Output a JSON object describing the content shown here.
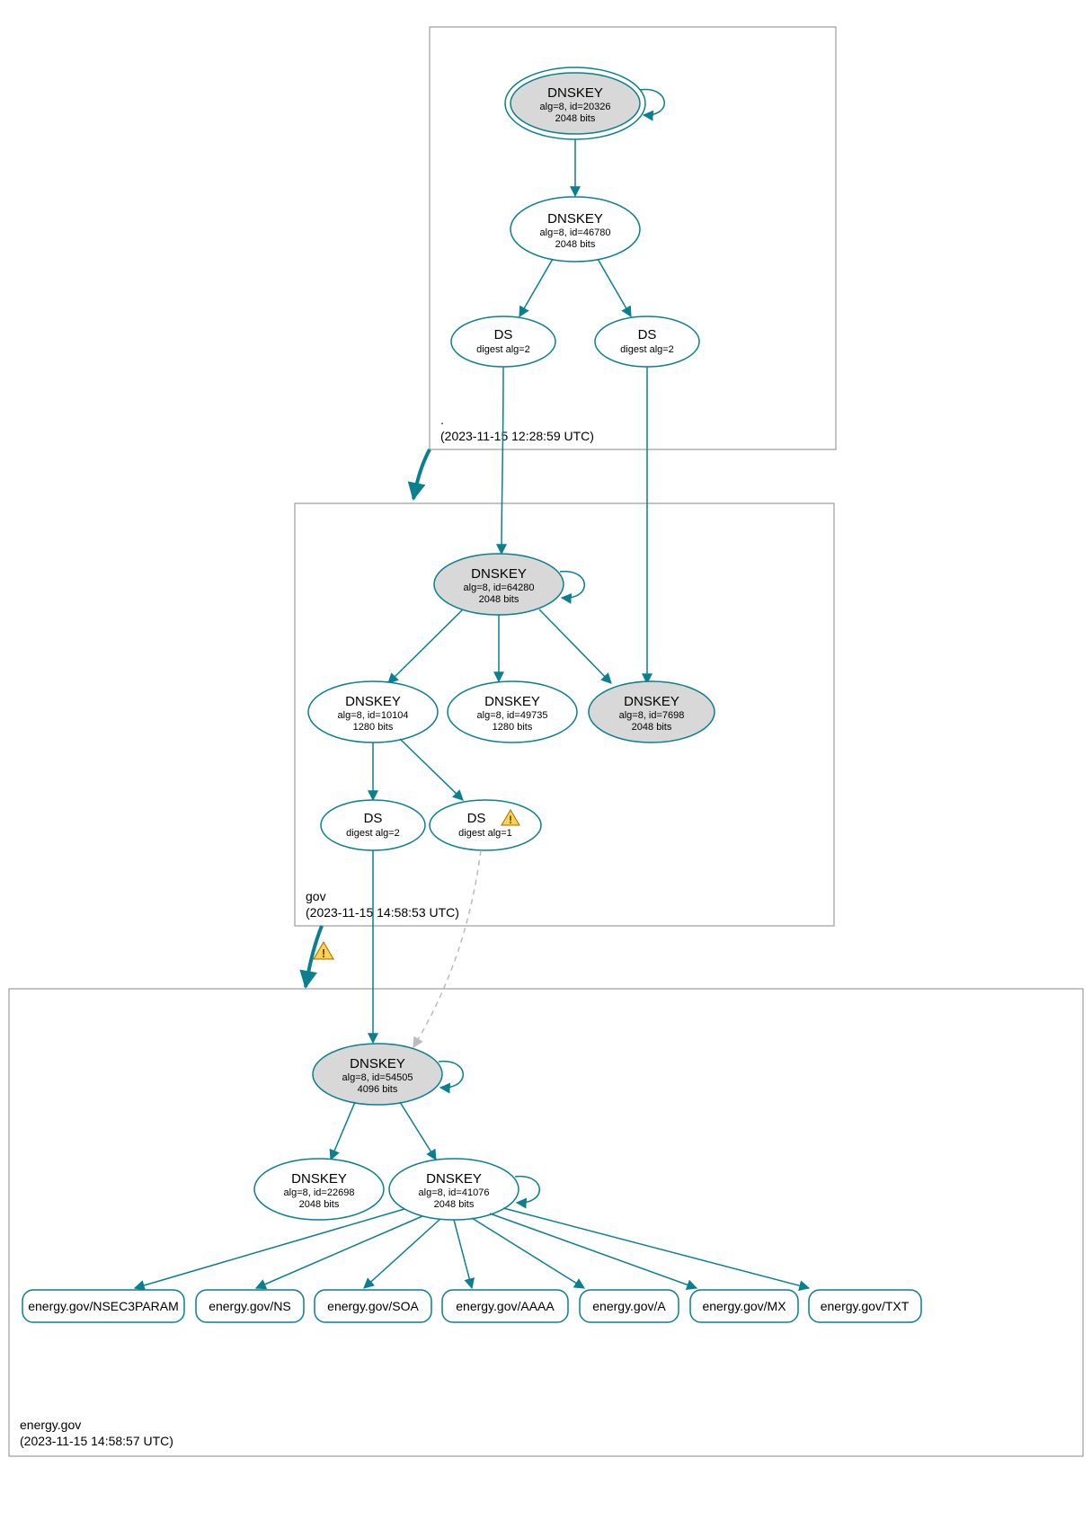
{
  "zones": {
    "root": {
      "name": ".",
      "timestamp": "(2023-11-15 12:28:59 UTC)"
    },
    "gov": {
      "name": "gov",
      "timestamp": "(2023-11-15 14:58:53 UTC)"
    },
    "energy": {
      "name": "energy.gov",
      "timestamp": "(2023-11-15 14:58:57 UTC)"
    }
  },
  "nodes": {
    "root_ksk": {
      "title": "DNSKEY",
      "sub": "alg=8, id=20326",
      "sub2": "2048 bits"
    },
    "root_zsk": {
      "title": "DNSKEY",
      "sub": "alg=8, id=46780",
      "sub2": "2048 bits"
    },
    "root_ds1": {
      "title": "DS",
      "sub": "digest alg=2"
    },
    "root_ds2": {
      "title": "DS",
      "sub": "digest alg=2"
    },
    "gov_ksk": {
      "title": "DNSKEY",
      "sub": "alg=8, id=64280",
      "sub2": "2048 bits"
    },
    "gov_zsk1": {
      "title": "DNSKEY",
      "sub": "alg=8, id=10104",
      "sub2": "1280 bits"
    },
    "gov_zsk2": {
      "title": "DNSKEY",
      "sub": "alg=8, id=49735",
      "sub2": "1280 bits"
    },
    "gov_key3": {
      "title": "DNSKEY",
      "sub": "alg=8, id=7698",
      "sub2": "2048 bits"
    },
    "gov_ds1": {
      "title": "DS",
      "sub": "digest alg=2"
    },
    "gov_ds2": {
      "title": "DS",
      "sub": "digest alg=1"
    },
    "en_ksk": {
      "title": "DNSKEY",
      "sub": "alg=8, id=54505",
      "sub2": "4096 bits"
    },
    "en_zsk1": {
      "title": "DNSKEY",
      "sub": "alg=8, id=22698",
      "sub2": "2048 bits"
    },
    "en_zsk2": {
      "title": "DNSKEY",
      "sub": "alg=8, id=41076",
      "sub2": "2048 bits"
    }
  },
  "rrsets": {
    "nsec3": "energy.gov/NSEC3PARAM",
    "ns": "energy.gov/NS",
    "soa": "energy.gov/SOA",
    "aaaa": "energy.gov/AAAA",
    "a": "energy.gov/A",
    "mx": "energy.gov/MX",
    "txt": "energy.gov/TXT"
  },
  "chart_data": {
    "type": "graph",
    "zones": [
      {
        "name": ".",
        "timestamp": "2023-11-15 12:28:59 UTC"
      },
      {
        "name": "gov",
        "timestamp": "2023-11-15 14:58:53 UTC"
      },
      {
        "name": "energy.gov",
        "timestamp": "2023-11-15 14:58:57 UTC"
      }
    ],
    "nodes": [
      {
        "id": "root_ksk",
        "zone": ".",
        "type": "DNSKEY",
        "alg": 8,
        "keyid": 20326,
        "bits": 2048,
        "ksk": true,
        "trustanchor": true
      },
      {
        "id": "root_zsk",
        "zone": ".",
        "type": "DNSKEY",
        "alg": 8,
        "keyid": 46780,
        "bits": 2048
      },
      {
        "id": "root_ds1",
        "zone": ".",
        "type": "DS",
        "digest_alg": 2
      },
      {
        "id": "root_ds2",
        "zone": ".",
        "type": "DS",
        "digest_alg": 2
      },
      {
        "id": "gov_ksk",
        "zone": "gov",
        "type": "DNSKEY",
        "alg": 8,
        "keyid": 64280,
        "bits": 2048,
        "ksk": true
      },
      {
        "id": "gov_zsk1",
        "zone": "gov",
        "type": "DNSKEY",
        "alg": 8,
        "keyid": 10104,
        "bits": 1280
      },
      {
        "id": "gov_zsk2",
        "zone": "gov",
        "type": "DNSKEY",
        "alg": 8,
        "keyid": 49735,
        "bits": 1280
      },
      {
        "id": "gov_key3",
        "zone": "gov",
        "type": "DNSKEY",
        "alg": 8,
        "keyid": 7698,
        "bits": 2048,
        "ksk": true
      },
      {
        "id": "gov_ds1",
        "zone": "gov",
        "type": "DS",
        "digest_alg": 2
      },
      {
        "id": "gov_ds2",
        "zone": "gov",
        "type": "DS",
        "digest_alg": 1,
        "warning": true
      },
      {
        "id": "en_ksk",
        "zone": "energy.gov",
        "type": "DNSKEY",
        "alg": 8,
        "keyid": 54505,
        "bits": 4096,
        "ksk": true
      },
      {
        "id": "en_zsk1",
        "zone": "energy.gov",
        "type": "DNSKEY",
        "alg": 8,
        "keyid": 22698,
        "bits": 2048
      },
      {
        "id": "en_zsk2",
        "zone": "energy.gov",
        "type": "DNSKEY",
        "alg": 8,
        "keyid": 41076,
        "bits": 2048
      },
      {
        "id": "rr_nsec3",
        "zone": "energy.gov",
        "type": "RRSET",
        "name": "energy.gov/NSEC3PARAM"
      },
      {
        "id": "rr_ns",
        "zone": "energy.gov",
        "type": "RRSET",
        "name": "energy.gov/NS"
      },
      {
        "id": "rr_soa",
        "zone": "energy.gov",
        "type": "RRSET",
        "name": "energy.gov/SOA"
      },
      {
        "id": "rr_aaaa",
        "zone": "energy.gov",
        "type": "RRSET",
        "name": "energy.gov/AAAA"
      },
      {
        "id": "rr_a",
        "zone": "energy.gov",
        "type": "RRSET",
        "name": "energy.gov/A"
      },
      {
        "id": "rr_mx",
        "zone": "energy.gov",
        "type": "RRSET",
        "name": "energy.gov/MX"
      },
      {
        "id": "rr_txt",
        "zone": "energy.gov",
        "type": "RRSET",
        "name": "energy.gov/TXT"
      }
    ],
    "edges": [
      {
        "from": "root_ksk",
        "to": "root_ksk",
        "style": "self"
      },
      {
        "from": "root_ksk",
        "to": "root_zsk"
      },
      {
        "from": "root_zsk",
        "to": "root_ds1"
      },
      {
        "from": "root_zsk",
        "to": "root_ds2"
      },
      {
        "from": "root_ds1",
        "to": "gov_ksk"
      },
      {
        "from": "root_ds2",
        "to": "gov_key3"
      },
      {
        "from": ".",
        "to": "gov",
        "style": "bold_zone"
      },
      {
        "from": "gov_ksk",
        "to": "gov_ksk",
        "style": "self"
      },
      {
        "from": "gov_ksk",
        "to": "gov_zsk1"
      },
      {
        "from": "gov_ksk",
        "to": "gov_zsk2"
      },
      {
        "from": "gov_ksk",
        "to": "gov_key3"
      },
      {
        "from": "gov_zsk1",
        "to": "gov_ds1"
      },
      {
        "from": "gov_zsk1",
        "to": "gov_ds2"
      },
      {
        "from": "gov_ds1",
        "to": "en_ksk"
      },
      {
        "from": "gov_ds2",
        "to": "en_ksk",
        "style": "dashed"
      },
      {
        "from": "gov",
        "to": "energy.gov",
        "style": "bold_zone",
        "warning": true
      },
      {
        "from": "en_ksk",
        "to": "en_ksk",
        "style": "self"
      },
      {
        "from": "en_ksk",
        "to": "en_zsk1"
      },
      {
        "from": "en_ksk",
        "to": "en_zsk2"
      },
      {
        "from": "en_zsk2",
        "to": "en_zsk2",
        "style": "self"
      },
      {
        "from": "en_zsk2",
        "to": "rr_nsec3"
      },
      {
        "from": "en_zsk2",
        "to": "rr_ns"
      },
      {
        "from": "en_zsk2",
        "to": "rr_soa"
      },
      {
        "from": "en_zsk2",
        "to": "rr_aaaa"
      },
      {
        "from": "en_zsk2",
        "to": "rr_a"
      },
      {
        "from": "en_zsk2",
        "to": "rr_mx"
      },
      {
        "from": "en_zsk2",
        "to": "rr_txt"
      }
    ]
  }
}
